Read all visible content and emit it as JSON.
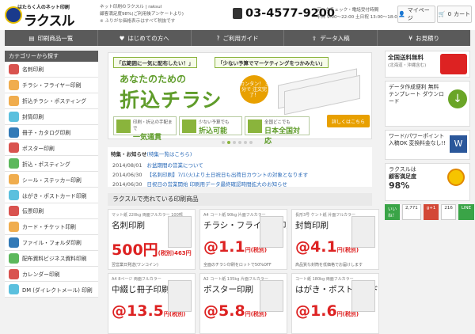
{
  "header": {
    "logo_small": "はたらく人のネット印刷",
    "logo_big": "ラクスル",
    "tagline1": "ネット印刷のラクスル | raksul",
    "tagline2": "顧客満足度98%(ご利用後アンケートより)",
    "tagline3": "※ ふりがな価格表示はすべて税抜です",
    "phone": "03-4577-9200",
    "hours_label": "データチェック・電話受付時間",
    "hours_time": "平日 9:00〜22:00 土日祝 13:00〜18:00",
    "mypage_label": "マイページ",
    "cart_label": "カート",
    "cart_count": "0"
  },
  "nav": [
    {
      "label": "印刷商品一覧",
      "icon": "printer-icon"
    },
    {
      "label": "はじめての方へ",
      "icon": "heart-icon"
    },
    {
      "label": "ご利用ガイド",
      "icon": "question-icon"
    },
    {
      "label": "データ入稿",
      "icon": "upload-icon"
    },
    {
      "label": "お見積り",
      "icon": "yen-icon"
    }
  ],
  "sidebar": {
    "title": "カテゴリーから探す",
    "items": [
      {
        "label": "名刺印刷",
        "color": "#d9534f"
      },
      {
        "label": "チラシ・フライヤー印刷",
        "color": "#f0ad4e"
      },
      {
        "label": "折込チラシ・ポスティング",
        "color": "#f0ad4e"
      },
      {
        "label": "封筒印刷",
        "color": "#5bc0de"
      },
      {
        "label": "冊子・カタログ印刷",
        "color": "#337ab7"
      },
      {
        "label": "ポスター印刷",
        "color": "#d9534f"
      },
      {
        "label": "折込・ポスティング",
        "color": "#5cb85c"
      },
      {
        "label": "シール・ステッカー印刷",
        "color": "#f0ad4e"
      },
      {
        "label": "はがき・ポストカード印刷",
        "color": "#5bc0de"
      },
      {
        "label": "伝票印刷",
        "color": "#d9534f"
      },
      {
        "label": "カード・チケット印刷",
        "color": "#f0ad4e"
      },
      {
        "label": "ファイル・フォルダ印刷",
        "color": "#337ab7"
      },
      {
        "label": "配布資料ビジネス資料印刷",
        "color": "#5cb85c"
      },
      {
        "label": "カレンダー印刷",
        "color": "#d9534f"
      },
      {
        "label": "DM (ダイレクトメール) 印刷",
        "color": "#5bc0de"
      }
    ]
  },
  "banner": {
    "check1": "「広範囲に一気に配布したい！」",
    "check2": "「少ない予算でマーケティングをつかみたい」",
    "subtitle": "あなたのための",
    "title": "折込チラシ",
    "badge": "カンタン！ 3分で 注文完了！",
    "feat1_small": "印刷・折込の手配まで",
    "feat1_big": "一気通貫",
    "feat2_small": "少ない予算でも",
    "feat2_big": "折込可能",
    "feat3_small": "全国どこでも",
    "feat3_big": "日本全国対応",
    "detail": "詳しくはこちら"
  },
  "news": {
    "title": "特集・お知らせ",
    "title_link": "(特集一覧はこちら)",
    "items": [
      {
        "date": "2014/08/01",
        "text": "お盆期間の営業について"
      },
      {
        "date": "2014/06/30",
        "text": "【名刺印刷】7/1(火)より土日祝日も出荷日カウントの対象となります"
      },
      {
        "date": "2014/06/30",
        "text": "日祝日の営業開始 印刷用データ最終確認時間拡大のお知らせ"
      }
    ]
  },
  "products": {
    "title": "ラクスルで売れている印刷商品",
    "items": [
      {
        "spec": "マット紙 220kg 両面フルカラー 100部",
        "name": "名刺印刷",
        "price": "500円",
        "sub": "(税別)463円",
        "note": "翌営業日発送(ワンコイン)"
      },
      {
        "spec": "A4 コート紙 90kg 片面フルカラー",
        "name": "チラシ・フライヤー印刷",
        "price": "@1.1",
        "sub": "円(税別)",
        "note": "全面のチラシ印刷をロットで50%OFF"
      },
      {
        "spec": "長形3号 ケント紙 片面フルカラー",
        "name": "封筒印刷",
        "price": "@4.1",
        "sub": "円(税別)",
        "note": "高品質な封筒を低価格でお届けします"
      },
      {
        "spec": "A4 8ページ 両面フルカラー",
        "name": "中綴じ冊子印刷",
        "price": "@13.5",
        "sub": "円(税別)",
        "note": ""
      },
      {
        "spec": "A2 コート紙 135kg 片面フルカラー",
        "name": "ポスター印刷",
        "price": "@5.8",
        "sub": "円(税別)",
        "note": ""
      },
      {
        "spec": "コート紙 180kg 両面フルカラー",
        "name": "はがき・ポストカード印刷",
        "price": "@1.6",
        "sub": "円(税別)",
        "note": ""
      }
    ]
  },
  "right": {
    "shipping_title": "全国送料無料",
    "shipping_sub": "(北海道・沖縄含む)",
    "template_text": "データ作成便利 無料テンプレート ダウンロード",
    "word_text": "ワード/パワーポイント 入稿OK 変換料金なし!!",
    "satisfaction_1": "ラクスルは",
    "satisfaction_2": "顧客満足度",
    "satisfaction_3": "98%",
    "like_label": "いいね！",
    "like_count": "2,771",
    "gplus_label": "g+1",
    "gplus_count": "216",
    "line_label": "LINE"
  }
}
